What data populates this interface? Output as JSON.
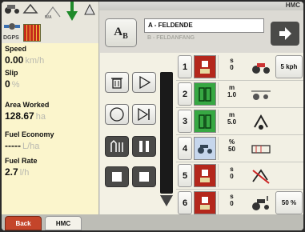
{
  "app": {
    "title": "HMC"
  },
  "status": {
    "gps_label": "DGPS",
    "mini_label": "N/A"
  },
  "info": {
    "speed": {
      "label": "Speed",
      "value": "0.00",
      "unit": "km/h"
    },
    "slip": {
      "label": "Slip",
      "value": "0",
      "unit": "%"
    },
    "area": {
      "label": "Area Worked",
      "value": "128.67",
      "unit": "ha"
    },
    "fuel_economy": {
      "label": "Fuel Economy",
      "value": "-----",
      "unit": "L/ha"
    },
    "fuel_rate": {
      "label": "Fuel Rate",
      "value": "2.7",
      "unit": "l/h"
    }
  },
  "tabs": {
    "back": "Back",
    "hmc": "HMC"
  },
  "header": {
    "ab_label": "A",
    "ab_sub": "B",
    "seq_a": "A - FELDENDE",
    "seq_b": "B - FELDANFANG"
  },
  "rows": [
    {
      "num": "1",
      "func_color": "red",
      "unit": "s",
      "value": "0",
      "side": "5 kph"
    },
    {
      "num": "2",
      "func_color": "green",
      "unit": "m",
      "value": "1.0",
      "side": ""
    },
    {
      "num": "3",
      "func_color": "green",
      "unit": "m",
      "value": "5.0",
      "side": ""
    },
    {
      "num": "4",
      "func_color": "blue",
      "unit": "%",
      "value": "50",
      "side": ""
    },
    {
      "num": "5",
      "func_color": "red",
      "unit": "s",
      "value": "0",
      "side": ""
    },
    {
      "num": "6",
      "func_color": "red",
      "unit": "s",
      "value": "0",
      "side": "50 %"
    }
  ]
}
